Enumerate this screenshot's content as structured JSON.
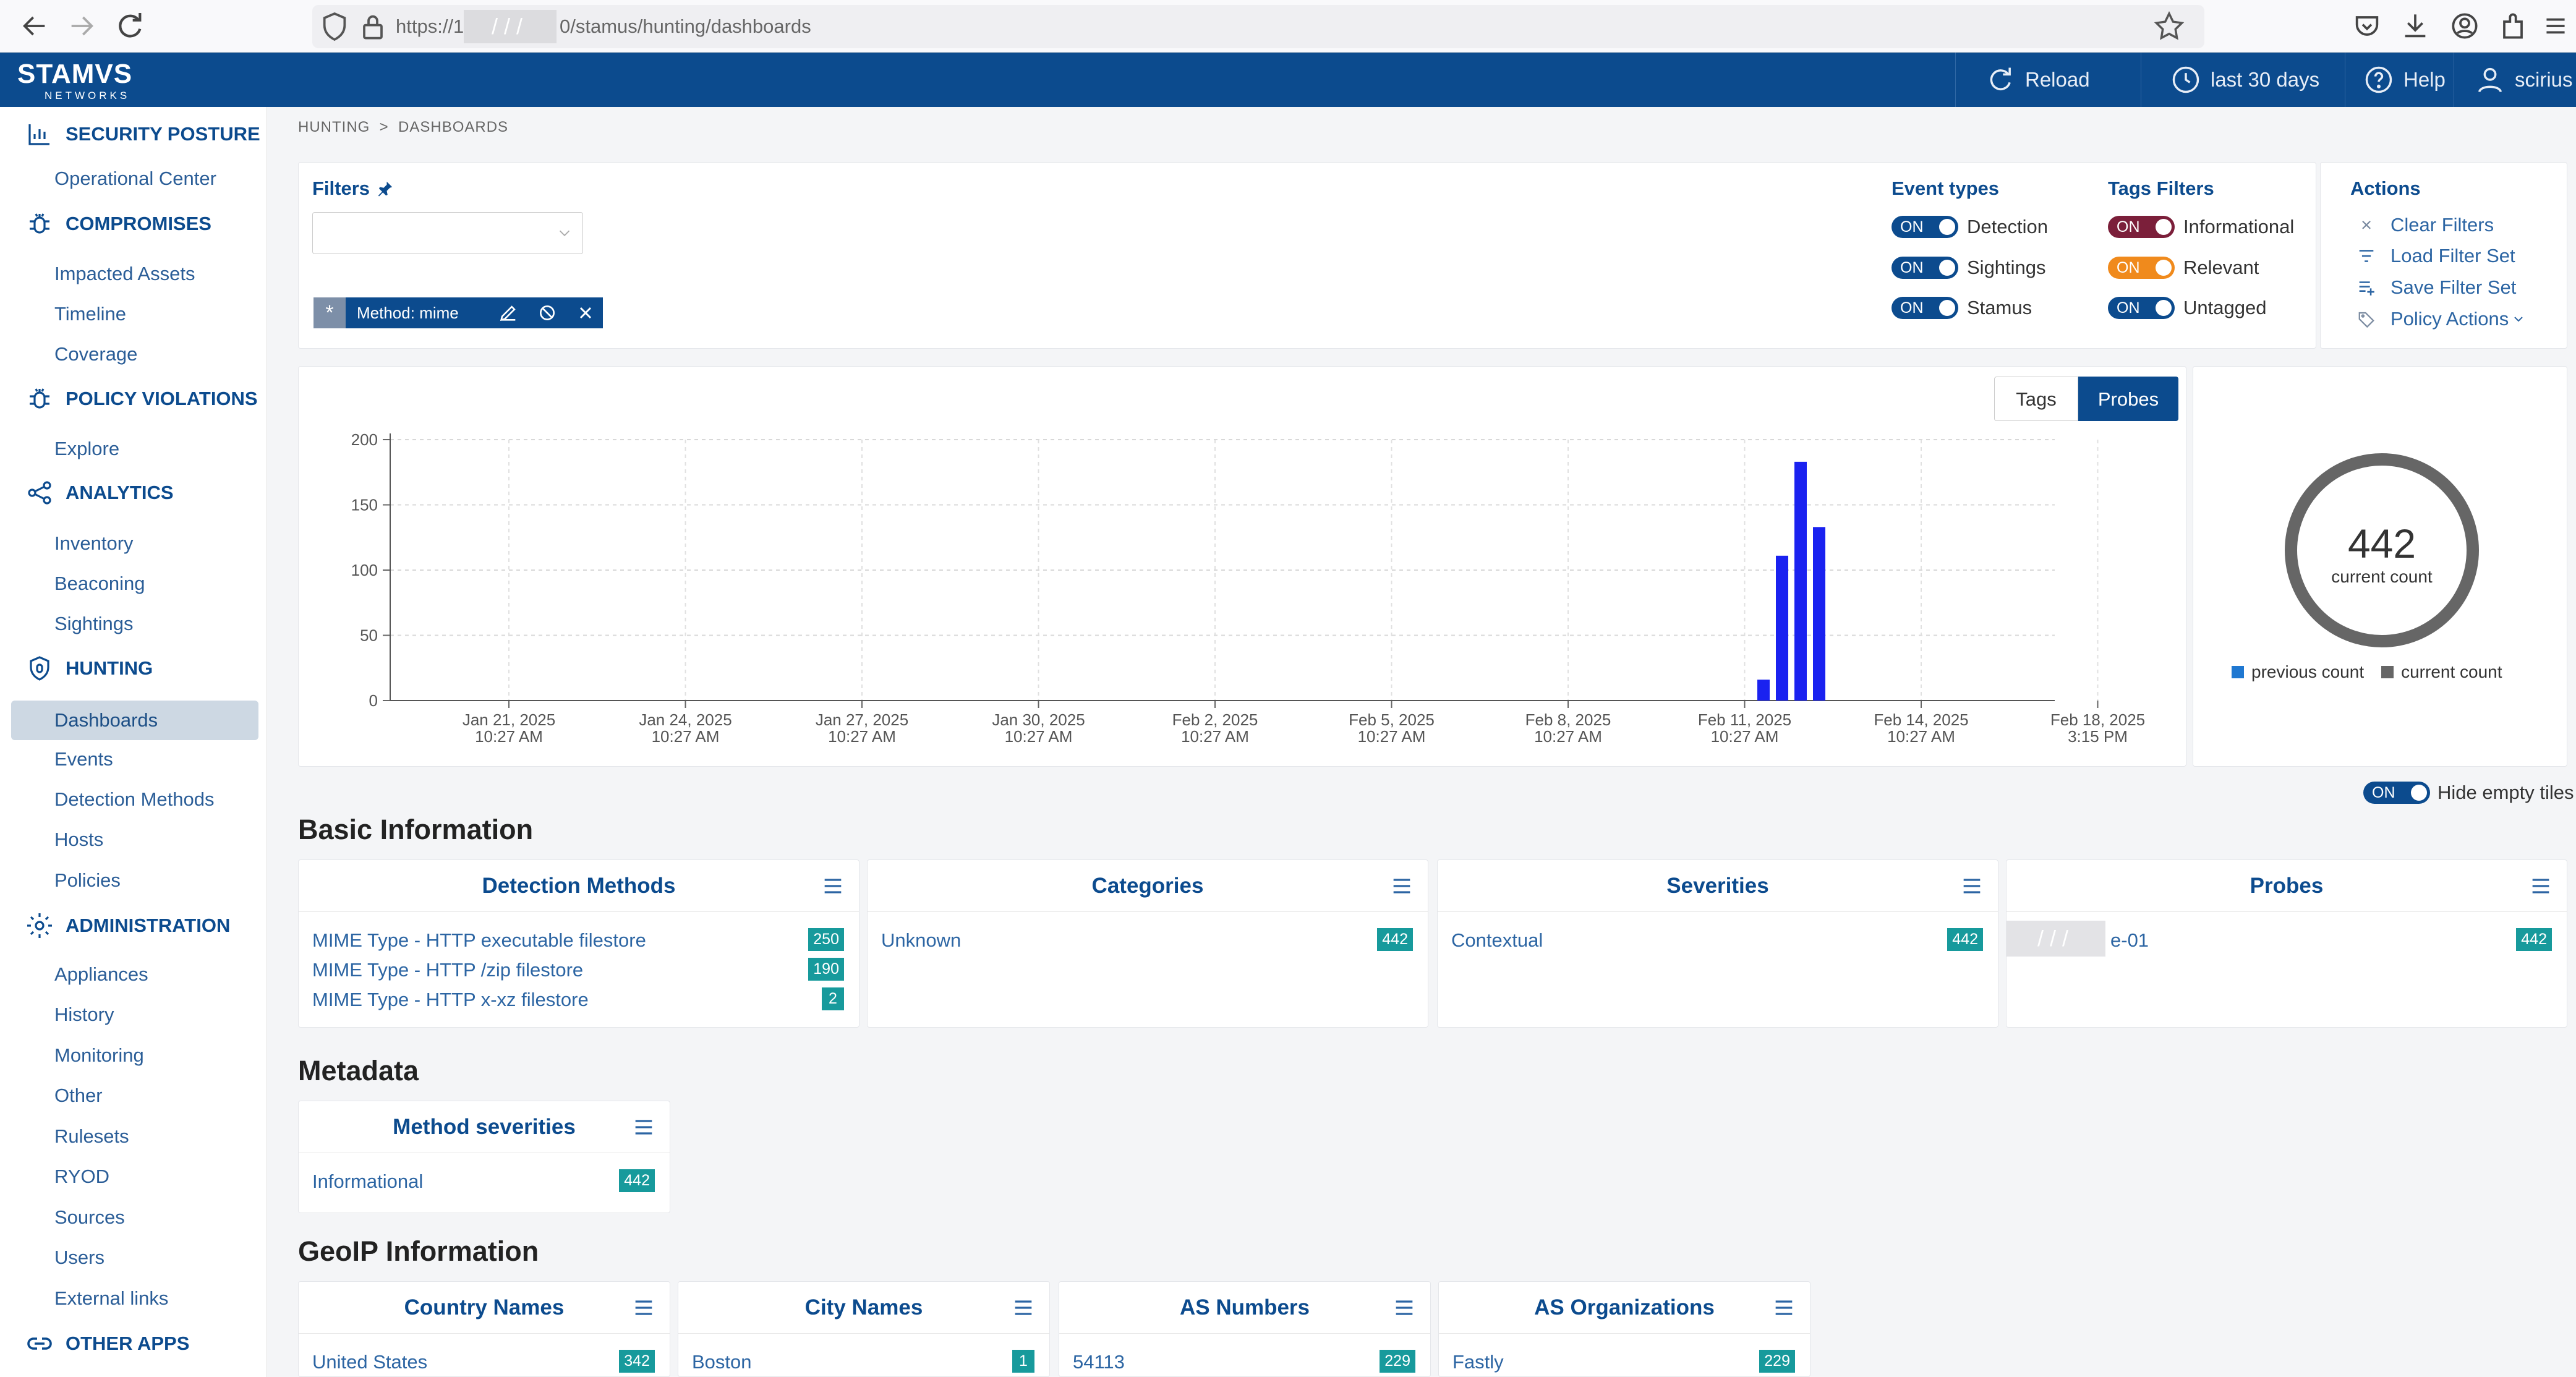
{
  "browser": {
    "url_prefix": "https://1",
    "url_suffix": "0/stamus/hunting/dashboards",
    "redacted": "///"
  },
  "header": {
    "logo": "STAMVS",
    "logo_sub": "NETWORKS",
    "reload": "Reload",
    "range": "last 30 days",
    "help": "Help",
    "user": "scirius"
  },
  "sidebar": {
    "security_posture": "SECURITY POSTURE",
    "operational_center": "Operational Center",
    "compromises": "COMPROMISES",
    "impacted_assets": "Impacted Assets",
    "timeline": "Timeline",
    "coverage": "Coverage",
    "policy_violations": "POLICY VIOLATIONS",
    "explore": "Explore",
    "analytics": "ANALYTICS",
    "inventory": "Inventory",
    "beaconing": "Beaconing",
    "sightings": "Sightings",
    "hunting": "HUNTING",
    "dashboards": "Dashboards",
    "events": "Events",
    "detection_methods": "Detection Methods",
    "hosts": "Hosts",
    "policies": "Policies",
    "administration": "ADMINISTRATION",
    "appliances": "Appliances",
    "history": "History",
    "monitoring": "Monitoring",
    "other": "Other",
    "rulesets": "Rulesets",
    "ryod": "RYOD",
    "sources": "Sources",
    "users": "Users",
    "external_links": "External links",
    "other_apps": "OTHER APPS"
  },
  "breadcrumb": {
    "hunting": "HUNTING",
    "sep": ">",
    "dashboards": "DASHBOARDS"
  },
  "filters": {
    "title": "Filters",
    "chip_label": "Method: mime",
    "event_types_title": "Event types",
    "tags_filters_title": "Tags Filters",
    "toggle_on": "ON",
    "detection": "Detection",
    "sightings": "Sightings",
    "stamus": "Stamus",
    "informational": "Informational",
    "relevant": "Relevant",
    "untagged": "Untagged",
    "actions_title": "Actions",
    "clear_filters": "Clear Filters",
    "load_filter_set": "Load Filter Set",
    "save_filter_set": "Save Filter Set",
    "policy_actions": "Policy Actions",
    "colors": {
      "informational": "#7b1f3a",
      "relevant": "#f08a1c",
      "default": "#0c4b8e"
    }
  },
  "chart_tabs": {
    "tags": "Tags",
    "probes": "Probes"
  },
  "chart_data": {
    "type": "bar",
    "ylim": [
      0,
      200
    ],
    "yticks": [
      0,
      50,
      100,
      150,
      200
    ],
    "xtick_labels": [
      [
        "Jan 21, 2025",
        "10:27 AM"
      ],
      [
        "Jan 24, 2025",
        "10:27 AM"
      ],
      [
        "Jan 27, 2025",
        "10:27 AM"
      ],
      [
        "Jan 30, 2025",
        "10:27 AM"
      ],
      [
        "Feb 2, 2025",
        "10:27 AM"
      ],
      [
        "Feb 5, 2025",
        "10:27 AM"
      ],
      [
        "Feb 8, 2025",
        "10:27 AM"
      ],
      [
        "Feb 11, 2025",
        "10:27 AM"
      ],
      [
        "Feb 14, 2025",
        "10:27 AM"
      ],
      [
        "Feb 18, 2025",
        "3:15 PM"
      ]
    ],
    "values": [
      16,
      111,
      183,
      133
    ],
    "bar_color": "#1a22f0",
    "grid": true
  },
  "donut": {
    "value": "442",
    "label": "current count",
    "legend_previous": "previous count",
    "legend_current": "current count",
    "color_previous": "#1f78d1",
    "color_current": "#666666"
  },
  "hide_empty": {
    "toggle": "ON",
    "label": "Hide empty tiles"
  },
  "sections": {
    "basic": "Basic Information",
    "metadata": "Metadata",
    "geoip": "GeoIP Information"
  },
  "tiles": {
    "detection_methods": {
      "title": "Detection Methods",
      "rows": [
        {
          "label": "MIME Type - HTTP executable filestore",
          "count": "250"
        },
        {
          "label": "MIME Type - HTTP /zip filestore",
          "count": "190"
        },
        {
          "label": "MIME Type - HTTP x-xz filestore",
          "count": "2"
        }
      ]
    },
    "categories": {
      "title": "Categories",
      "rows": [
        {
          "label": "Unknown",
          "count": "442"
        }
      ]
    },
    "severities": {
      "title": "Severities",
      "rows": [
        {
          "label": "Contextual",
          "count": "442"
        }
      ]
    },
    "probes": {
      "title": "Probes",
      "rows": [
        {
          "label": "e-01",
          "count": "442"
        }
      ]
    },
    "method_severities": {
      "title": "Method severities",
      "rows": [
        {
          "label": "Informational",
          "count": "442"
        }
      ]
    },
    "country_names": {
      "title": "Country Names",
      "rows": [
        {
          "label": "United States",
          "count": "342"
        }
      ]
    },
    "city_names": {
      "title": "City Names",
      "rows": [
        {
          "label": "Boston",
          "count": "1"
        }
      ]
    },
    "as_numbers": {
      "title": "AS Numbers",
      "rows": [
        {
          "label": "54113",
          "count": "229"
        }
      ]
    },
    "as_organizations": {
      "title": "AS Organizations",
      "rows": [
        {
          "label": "Fastly",
          "count": "229"
        }
      ]
    }
  }
}
